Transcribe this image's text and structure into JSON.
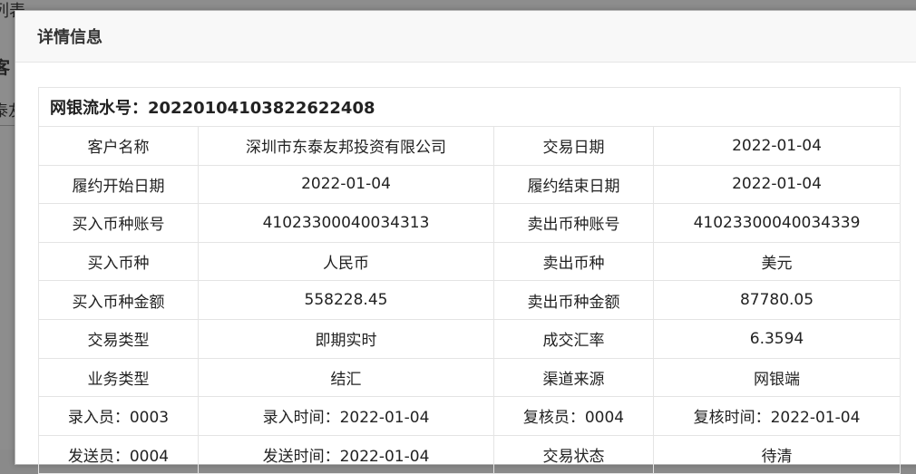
{
  "background": {
    "text_top": "列表",
    "text_mid": "客",
    "text_low": "泰友"
  },
  "dialog": {
    "title": "详情信息",
    "serial_label": "网银流水号：",
    "serial_value": "20220104103822622408",
    "rows": [
      [
        "客户名称",
        "深圳市东泰友邦投资有限公司",
        "交易日期",
        "2022-01-04"
      ],
      [
        "履约开始日期",
        "2022-01-04",
        "履约结束日期",
        "2022-01-04"
      ],
      [
        "买入币种账号",
        "41023300040034313",
        "卖出币种账号",
        "41023300040034339"
      ],
      [
        "买入币种",
        "人民币",
        "卖出币种",
        "美元"
      ],
      [
        "买入币种金额",
        "558228.45",
        "卖出币种金额",
        "87780.05"
      ],
      [
        "交易类型",
        "即期实时",
        "成交汇率",
        "6.3594"
      ],
      [
        "业务类型",
        "结汇",
        "渠道来源",
        "网银端"
      ],
      [
        "录入员：0003",
        "录入时间：2022-01-04",
        "复核员：0004",
        "复核时间：2022-01-04"
      ],
      [
        "发送员：0004",
        "发送时间：2022-01-04",
        "交易状态",
        "待清"
      ]
    ]
  }
}
